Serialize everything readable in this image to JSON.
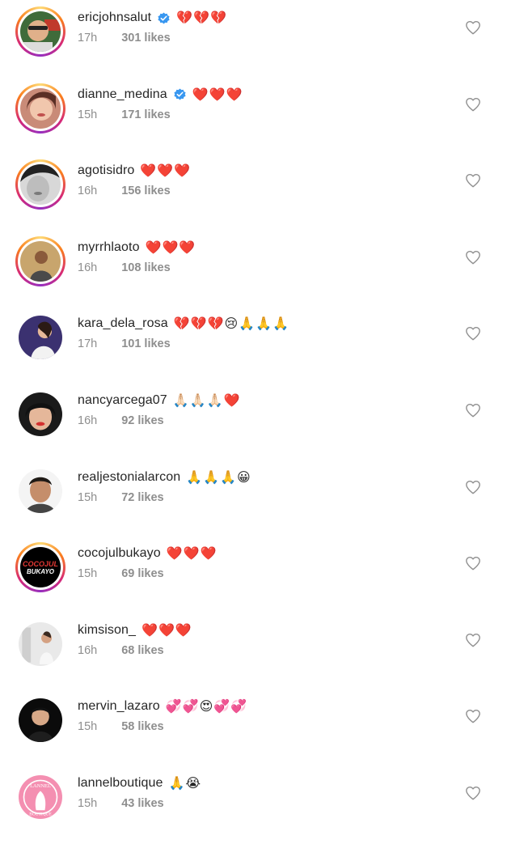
{
  "colors": {
    "username": "#262626",
    "meta": "#8e8e8e",
    "verified": "#3897f0",
    "heart_outline": "#8e8e8e"
  },
  "comments": [
    {
      "username": "ericjohnsalut",
      "verified": true,
      "comment": "💔💔💔",
      "time": "17h",
      "likes": "301 likes",
      "ring": true
    },
    {
      "username": "dianne_medina",
      "verified": true,
      "comment": "❤️❤️❤️",
      "time": "15h",
      "likes": "171 likes",
      "ring": true
    },
    {
      "username": "agotisidro",
      "verified": false,
      "comment": "❤️❤️❤️",
      "time": "16h",
      "likes": "156 likes",
      "ring": true
    },
    {
      "username": "myrrhlaoto",
      "verified": false,
      "comment": "❤️❤️❤️",
      "time": "16h",
      "likes": "108 likes",
      "ring": true
    },
    {
      "username": "kara_dela_rosa",
      "verified": false,
      "comment": "💔💔💔😢🙏🙏🙏",
      "time": "17h",
      "likes": "101 likes",
      "ring": false
    },
    {
      "username": "nancyarcega07",
      "verified": false,
      "comment": "🙏🏻🙏🏻🙏🏻❤️",
      "time": "16h",
      "likes": "92 likes",
      "ring": false
    },
    {
      "username": "realjestonialarcon",
      "verified": false,
      "comment": "🙏🙏🙏😀",
      "time": "15h",
      "likes": "72 likes",
      "ring": false
    },
    {
      "username": "cocojulbukayo",
      "verified": false,
      "comment": "❤️❤️❤️",
      "time": "15h",
      "likes": "69 likes",
      "ring": true,
      "logo_text": [
        "COCOJUL",
        "BUKAYO"
      ]
    },
    {
      "username": "kimsison_",
      "verified": false,
      "comment": "❤️❤️❤️",
      "time": "16h",
      "likes": "68 likes",
      "ring": false
    },
    {
      "username": "mervin_lazaro",
      "verified": false,
      "comment": "💞💞😍💞💞",
      "time": "15h",
      "likes": "58 likes",
      "ring": false
    },
    {
      "username": "lannelboutique",
      "verified": false,
      "comment": "🙏😭",
      "time": "15h",
      "likes": "43 likes",
      "ring": false,
      "logo_text": [
        "LANNEL",
        "BOUTIQUE"
      ]
    }
  ]
}
